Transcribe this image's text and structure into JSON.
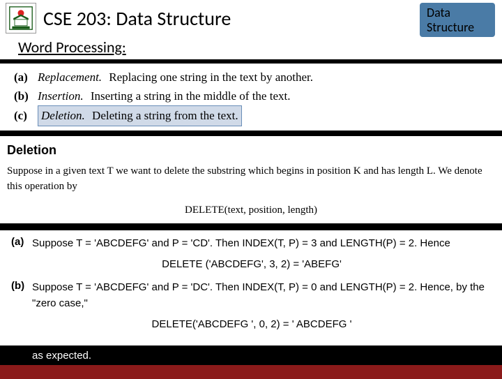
{
  "header": {
    "course_title": "CSE 203: Data Structure",
    "badge_line1": "Data",
    "badge_line2": "Structure"
  },
  "subheader": {
    "title": "Word Processing:"
  },
  "operations": {
    "a": {
      "label": "(a)",
      "term": "Replacement.",
      "desc": "Replacing one string in the text by another."
    },
    "b": {
      "label": "(b)",
      "term": "Insertion.",
      "desc": "Inserting a string in the middle of the text."
    },
    "c": {
      "label": "(c)",
      "term": "Deletion.",
      "desc": "Deleting a string from the text."
    }
  },
  "deletion": {
    "heading": "Deletion",
    "body": "Suppose in a given text T we want to delete the substring which begins in position K and has length L. We denote this operation by",
    "formula": "DELETE(text, position, length)"
  },
  "examples": {
    "a": {
      "label": "(a)",
      "line1": "Suppose T = 'ABCDEFG' and P = 'CD'. Then INDEX(T, P) = 3 and LENGTH(P) = 2. Hence",
      "center": "DELETE ('ABCDEFG', 3, 2) = 'ABEFG'"
    },
    "b": {
      "label": "(b)",
      "line1": "Suppose T = 'ABCDEFG' and P = 'DC'. Then INDEX(T, P) = 0 and LENGTH(P) = 2. Hence, by the \"zero case,\"",
      "center": "DELETE('ABCDEFG ', 0, 2) = ' ABCDEFG '"
    }
  },
  "footer": {
    "text": "as expected."
  }
}
